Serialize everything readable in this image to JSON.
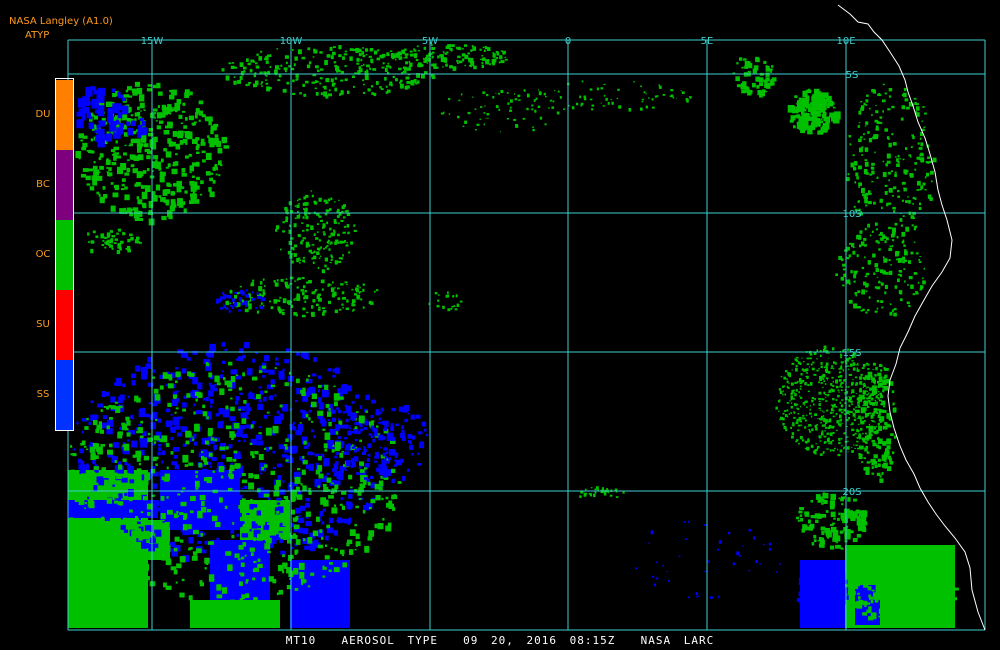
{
  "header": {
    "title": "NASA Langley (A1.0)",
    "product": "ATYP"
  },
  "legend": {
    "items": [
      {
        "label": "DU",
        "color": "#ff8000"
      },
      {
        "label": "BC",
        "color": "#7f007f"
      },
      {
        "label": "OC",
        "color": "#00c000"
      },
      {
        "label": "SU",
        "color": "#ff0000"
      },
      {
        "label": "SS",
        "color": "#0033ff"
      }
    ]
  },
  "map": {
    "lon_labels": [
      "15W",
      "10W",
      "5W",
      "0",
      "5E",
      "10E"
    ],
    "lat_labels": [
      "5S",
      "10S",
      "15S",
      "20S"
    ],
    "colors": {
      "grid": "#3fd0d0",
      "coast": "#ffffff",
      "oc": "#00c000",
      "ss": "#0000ff"
    }
  },
  "footer": {
    "caption": "MT10  AEROSOL TYPE  09 20, 2016 08:15Z  NASA LARC"
  }
}
